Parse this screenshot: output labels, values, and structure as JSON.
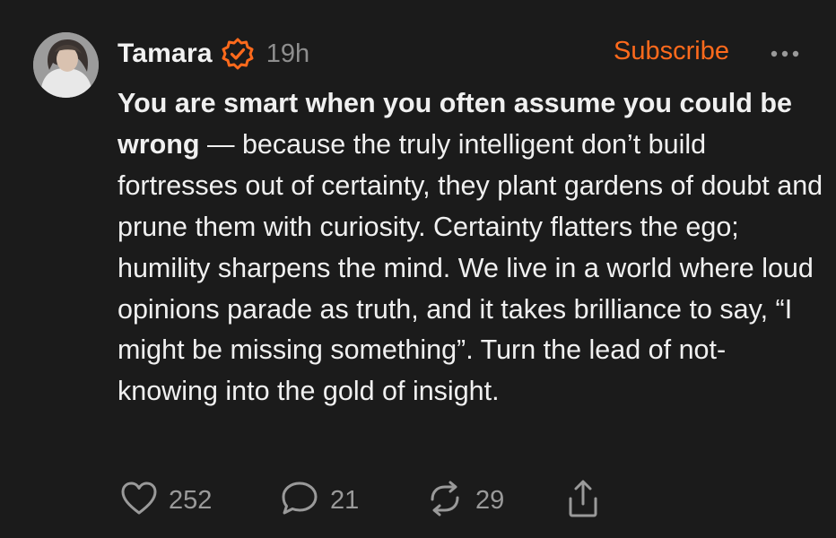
{
  "post": {
    "author": "Tamara",
    "timestamp": "19h",
    "subscribe_label": "Subscribe",
    "text_bold": "You are smart when you often assume you could be wrong",
    "text_rest": " — because the truly intelligent don’t build fortresses out of certainty, they plant gardens of doubt and prune them with curiosity. Certainty flatters the ego; humility sharpens the mind. We live in a world where loud opinions parade as truth, and it takes brilliance to say, “I might be missing something”. Turn the lead of not-knowing into the gold of insight."
  },
  "actions": {
    "likes": "252",
    "replies": "21",
    "reposts": "29"
  },
  "icons": {
    "verified": "verified-check-icon",
    "more": "more-dots-icon",
    "like": "heart-icon",
    "reply": "comment-bubble-icon",
    "repost": "repost-arrows-icon",
    "share": "share-icon"
  },
  "colors": {
    "background": "#1b1b1b",
    "accent": "#ff6a1c",
    "text": "#f0f0f0",
    "muted": "#8e8e8e"
  }
}
